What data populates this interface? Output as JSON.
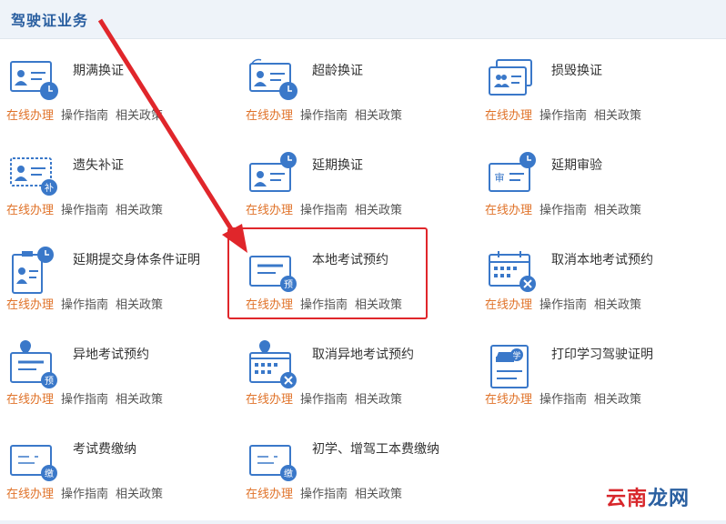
{
  "header": {
    "title": "驾驶证业务"
  },
  "links": {
    "online": "在线办理",
    "guide": "操作指南",
    "policy": "相关政策"
  },
  "services": [
    {
      "name": "期满换证",
      "icon": "card-clock-icon"
    },
    {
      "name": "超龄换证",
      "icon": "card-refresh-clock-icon"
    },
    {
      "name": "损毁换证",
      "icon": "broken-card-icon"
    },
    {
      "name": "遗失补证",
      "icon": "card-lost-icon",
      "badge": "补"
    },
    {
      "name": "延期换证",
      "icon": "card-clock-icon"
    },
    {
      "name": "延期审验",
      "icon": "audit-card-clock-icon",
      "badge": "审"
    },
    {
      "name": "延期提交身体条件证明",
      "icon": "id-badge-clock-icon"
    },
    {
      "name": "本地考试预约",
      "icon": "exam-reservation-icon",
      "badge": "预"
    },
    {
      "name": "取消本地考试预约",
      "icon": "calendar-cancel-icon"
    },
    {
      "name": "异地考试预约",
      "icon": "location-reservation-icon",
      "badge": "预"
    },
    {
      "name": "取消异地考试预约",
      "icon": "location-calendar-cancel-icon"
    },
    {
      "name": "打印学习驾驶证明",
      "icon": "learner-permit-icon",
      "badge": "学"
    },
    {
      "name": "考试费缴纳",
      "icon": "fee-payment-icon",
      "badge": "缴"
    },
    {
      "name": "初学、增驾工本费缴纳",
      "icon": "fee-payment-icon",
      "badge": "缴"
    }
  ],
  "watermark": {
    "text1": "云南",
    "text2": "龙网"
  },
  "colors": {
    "accent": "#e0732a",
    "icon_blue": "#3a78c9",
    "title_blue": "#2a5fa0",
    "highlight": "#e0262b"
  }
}
